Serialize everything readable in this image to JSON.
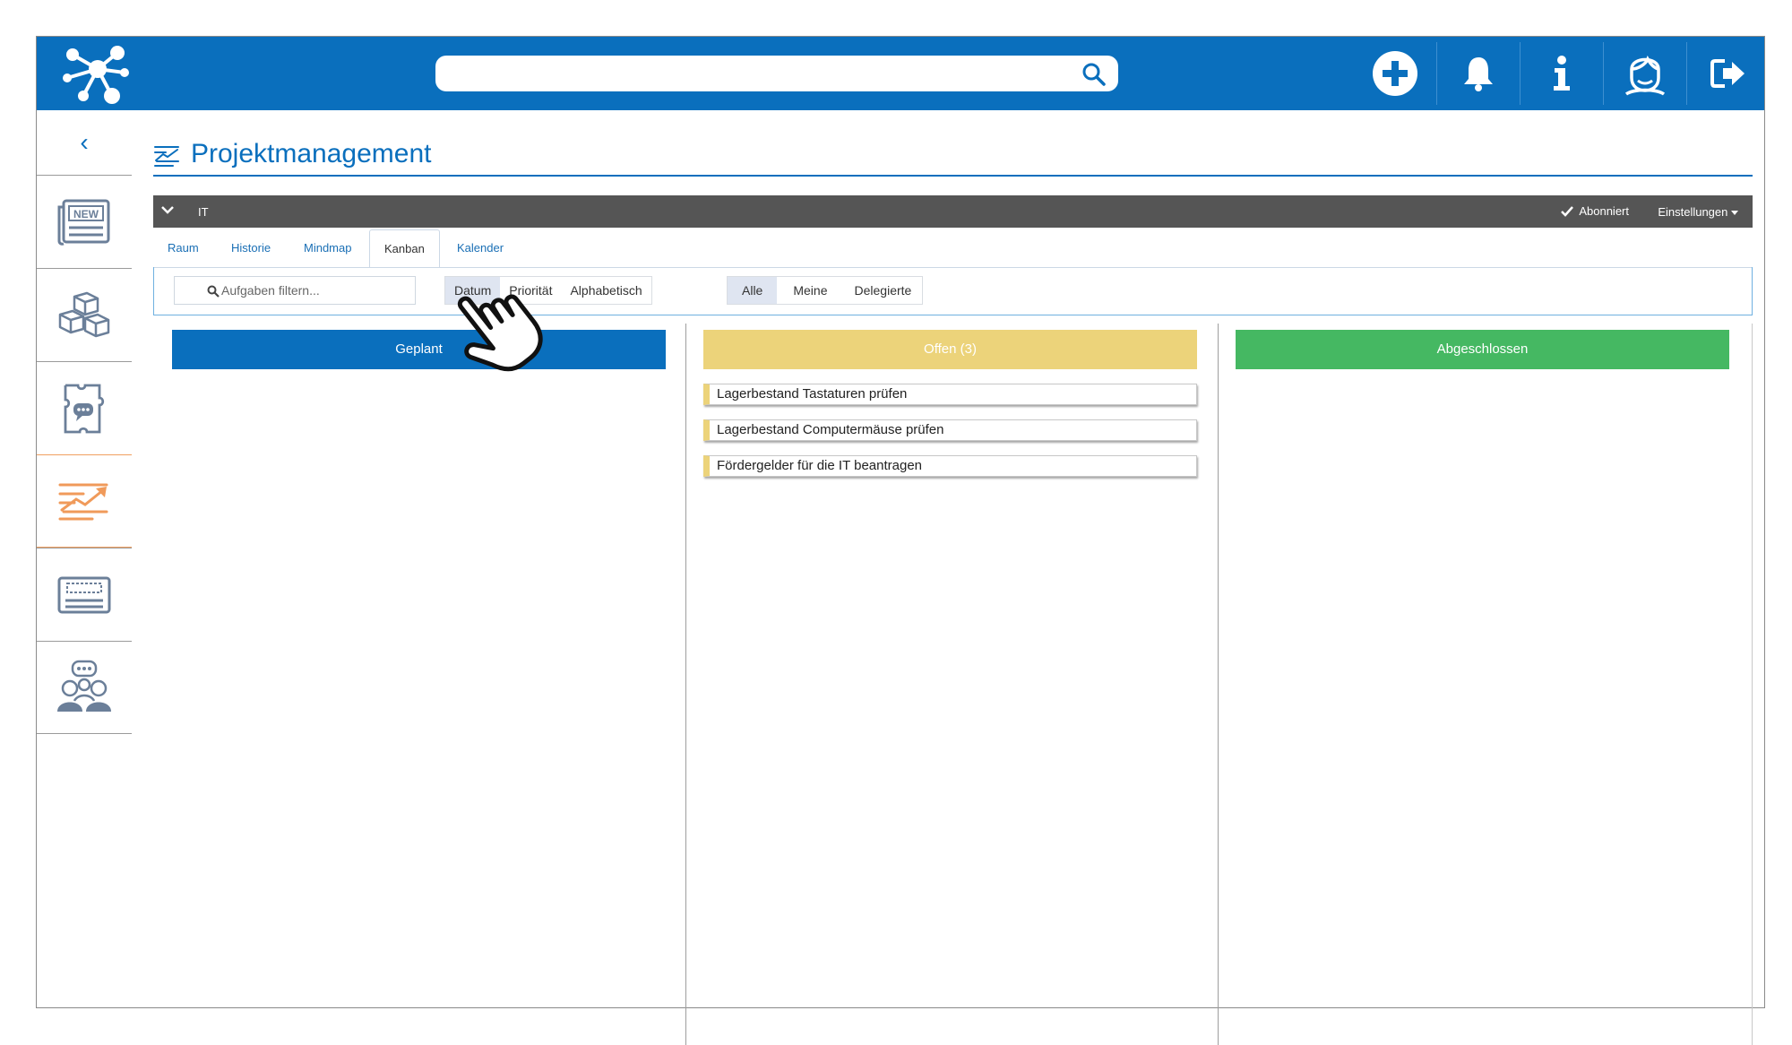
{
  "header": {
    "search": {
      "value": "",
      "placeholder": ""
    },
    "icons": [
      "add-icon",
      "bell-icon",
      "info-icon",
      "user-avatar-icon",
      "logout-icon"
    ],
    "brand_color": "#0a6fbd"
  },
  "sidebar": {
    "back_label": "‹",
    "items": [
      {
        "name": "news",
        "badge": "NEW",
        "active": false
      },
      {
        "name": "modules",
        "active": false
      },
      {
        "name": "discussion",
        "active": false
      },
      {
        "name": "projektmanagement",
        "active": true
      },
      {
        "name": "keyboard",
        "active": false
      },
      {
        "name": "community",
        "active": false
      }
    ]
  },
  "page": {
    "title": "Projektmanagement"
  },
  "space_bar": {
    "space_name": "IT",
    "subscribed_label": "Abonniert",
    "settings_label": "Einstellungen"
  },
  "tabs": [
    {
      "label": "Raum",
      "active": false
    },
    {
      "label": "Historie",
      "active": false
    },
    {
      "label": "Mindmap",
      "active": false
    },
    {
      "label": "Kanban",
      "active": true
    },
    {
      "label": "Kalender",
      "active": false
    }
  ],
  "filter": {
    "placeholder": "Aufgaben filtern...",
    "sort_options": [
      {
        "label": "Datum",
        "selected": true
      },
      {
        "label": "Priorität",
        "selected": false
      },
      {
        "label": "Alphabetisch",
        "selected": false
      }
    ],
    "scope_options": [
      {
        "label": "Alle",
        "selected": true
      },
      {
        "label": "Meine",
        "selected": false
      },
      {
        "label": "Delegierte",
        "selected": false
      }
    ]
  },
  "kanban": {
    "columns": [
      {
        "title": "Geplant",
        "color": "#0a6fbd",
        "cards": []
      },
      {
        "title": "Offen (3)",
        "color": "#ecd37a",
        "cards": [
          "Lagerbestand Tastaturen prüfen",
          "Lagerbestand Computermäuse prüfen",
          "Fördergelder für die IT beantragen"
        ]
      },
      {
        "title": "Abgeschlossen",
        "color": "#45b862",
        "cards": []
      }
    ]
  }
}
